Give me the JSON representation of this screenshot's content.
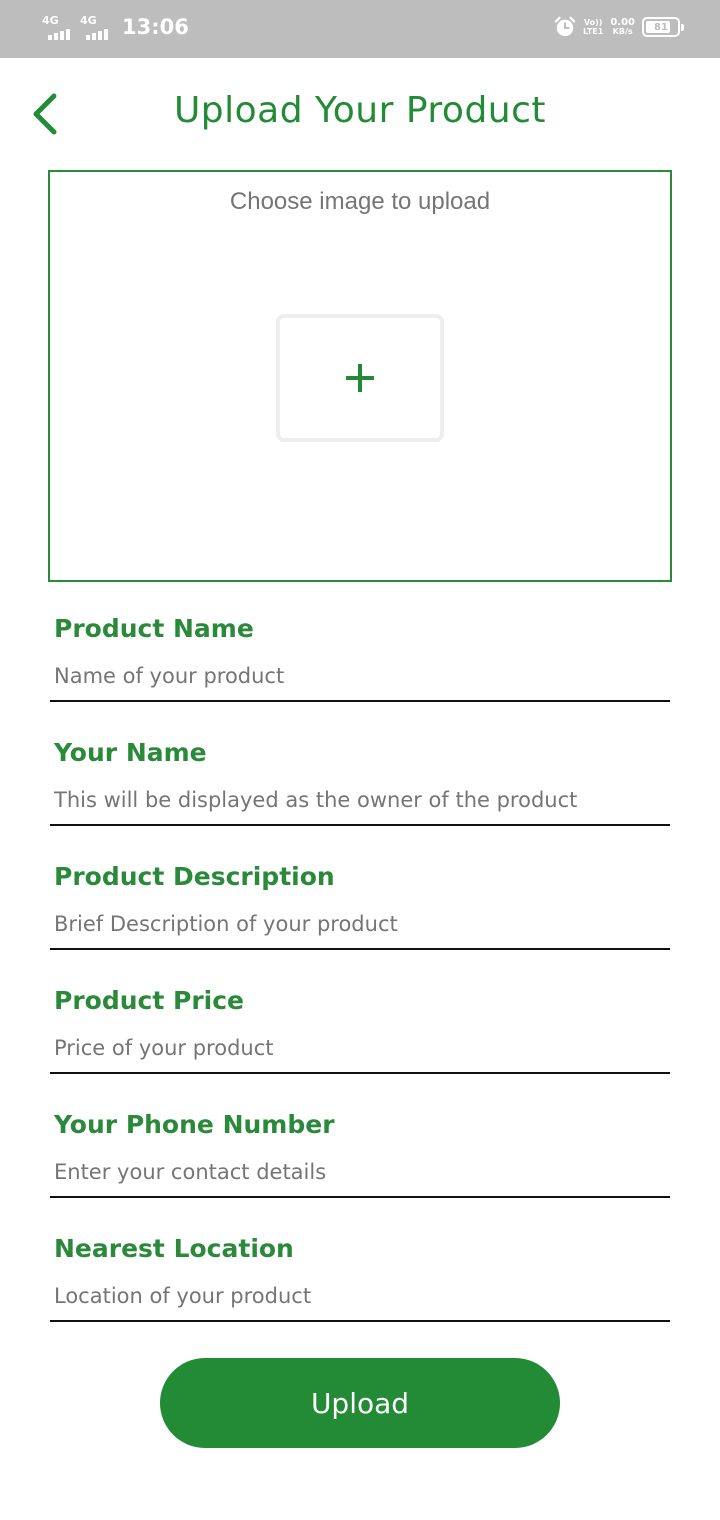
{
  "status_bar": {
    "time": "13:06",
    "sim1_label": "4G",
    "sim2_label": "4G",
    "volte_top": "Vo))",
    "volte_bottom": "LTE1",
    "speed_value": "0.00",
    "speed_unit": "KB/s",
    "battery_level": "81",
    "battery_percent": 81,
    "alarm_icon": "alarm-clock-icon"
  },
  "header": {
    "back_icon": "chevron-left-icon",
    "title": "Upload Your Product"
  },
  "image_picker": {
    "hint": "Choose image to upload",
    "add_icon": "plus-icon"
  },
  "form": {
    "fields": [
      {
        "label": "Product Name",
        "placeholder": "Name of your product",
        "value": ""
      },
      {
        "label": "Your Name",
        "placeholder": "This will be displayed as the owner of the product",
        "value": ""
      },
      {
        "label": "Product Description",
        "placeholder": "Brief Description of your product",
        "value": ""
      },
      {
        "label": "Product Price",
        "placeholder": "Price of your product",
        "value": ""
      },
      {
        "label": "Your Phone Number",
        "placeholder": "Enter your contact details",
        "value": ""
      },
      {
        "label": "Nearest Location",
        "placeholder": "Location of your product",
        "value": ""
      }
    ],
    "submit_label": "Upload"
  },
  "colors": {
    "accent": "#238a36",
    "status_bar": "#bdbdbd",
    "placeholder": "#757575"
  }
}
